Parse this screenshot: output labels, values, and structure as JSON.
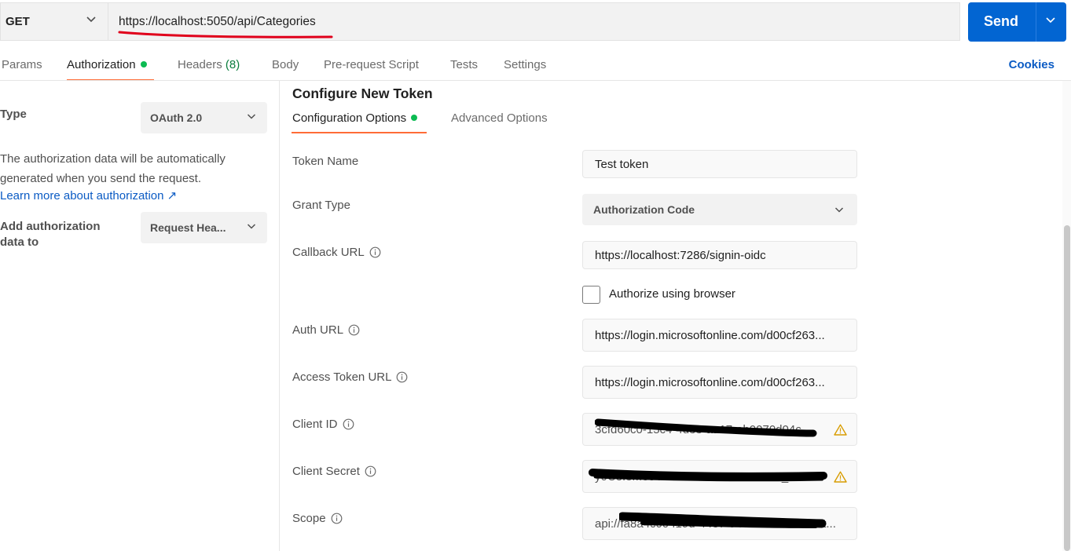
{
  "request": {
    "method": "GET",
    "url": "https://localhost:5050/api/Categories",
    "send_label": "Send"
  },
  "tabs": {
    "params": "Params",
    "authorization": "Authorization",
    "headers": "Headers",
    "headers_count": "(8)",
    "body": "Body",
    "prerequest": "Pre-request Script",
    "tests": "Tests",
    "settings": "Settings",
    "cookies": "Cookies"
  },
  "left": {
    "type_label": "Type",
    "type_value": "OAuth 2.0",
    "info_line1": "The authorization data will be automatically",
    "info_line2": "generated when you send the request.",
    "learn_more": "Learn more about authorization ↗",
    "add_to_line1": "Add authorization",
    "add_to_line2": "data to",
    "add_to_value": "Request Hea..."
  },
  "config": {
    "title": "Configure New Token",
    "subtab_config": "Configuration Options",
    "subtab_advanced": "Advanced Options",
    "fields": {
      "token_name": {
        "label": "Token Name",
        "value": "Test token"
      },
      "grant_type": {
        "label": "Grant Type",
        "value": "Authorization Code"
      },
      "callback_url": {
        "label": "Callback URL",
        "value": "https://localhost:7286/signin-oidc"
      },
      "authorize_browser": {
        "label": "Authorize using browser",
        "checked": false
      },
      "auth_url": {
        "label": "Auth URL",
        "value": "https://login.microsoftonline.com/d00cf263..."
      },
      "access_token_url": {
        "label": "Access Token URL",
        "value": "https://login.microsoftonline.com/d00cf263..."
      },
      "client_id": {
        "label": "Client ID",
        "value": "3cfd60c0-15c4-4d33-aa17-ab0070d04c..."
      },
      "client_secret": {
        "label": "Client Secret",
        "value": "y0Ce.eMe5YYiP1xKE.Pe.O0DnL1Y_Y1..."
      },
      "scope": {
        "label": "Scope",
        "value": "api://fa8a4c0c-f19d-4437-946c-a0d2c8d00ct..."
      }
    }
  },
  "colors": {
    "accent_orange": "#ff6c37",
    "send_blue": "#0265d2",
    "link_blue": "#0b5bc4",
    "status_green": "#0cbb52",
    "warning": "#d89c00",
    "annotation_red": "#e0001b"
  },
  "icons": {
    "method_dropdown": "chevron-down-icon",
    "send_dropdown": "chevron-down-icon",
    "info": "info-icon",
    "warning": "warning-icon"
  }
}
